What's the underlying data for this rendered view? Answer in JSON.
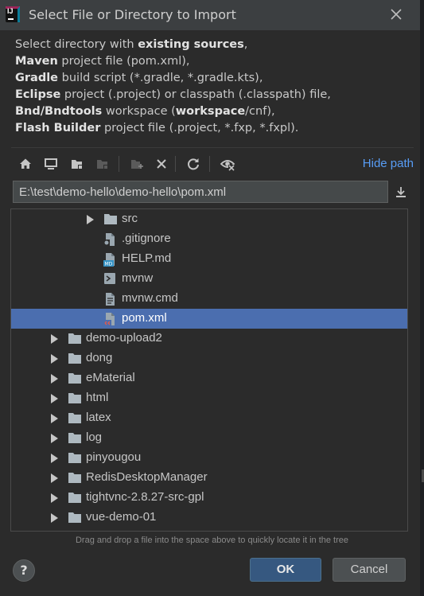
{
  "window": {
    "title": "Select File or Directory to Import",
    "app_icon_text": "IJ"
  },
  "description": [
    [
      {
        "t": "Select directory with ",
        "b": false
      },
      {
        "t": "existing sources",
        "b": true
      },
      {
        "t": ",",
        "b": false
      }
    ],
    [
      {
        "t": "Maven",
        "b": true
      },
      {
        "t": " project file (pom.xml),",
        "b": false
      }
    ],
    [
      {
        "t": "Gradle",
        "b": true
      },
      {
        "t": " build script (*.gradle, *.gradle.kts),",
        "b": false
      }
    ],
    [
      {
        "t": "Eclipse",
        "b": true
      },
      {
        "t": " project (.project) or classpath (.classpath) file,",
        "b": false
      }
    ],
    [
      {
        "t": "Bnd/Bndtools",
        "b": true
      },
      {
        "t": " workspace (",
        "b": false
      },
      {
        "t": "workspace",
        "b": true
      },
      {
        "t": "/cnf),",
        "b": false
      }
    ],
    [
      {
        "t": "Flash Builder",
        "b": true
      },
      {
        "t": " project file (.project, *.fxp, *.fxpl).",
        "b": false
      }
    ]
  ],
  "toolbar": {
    "hide_path_label": "Hide path"
  },
  "path": {
    "value": "E:\\test\\demo-hello\\demo-hello\\pom.xml"
  },
  "tree": [
    {
      "label": "src",
      "icon": "folder-icon",
      "level": 2,
      "arrow": true,
      "selected": false
    },
    {
      "label": ".gitignore",
      "icon": "gitignore-file-icon",
      "level": 2,
      "arrow": false,
      "selected": false
    },
    {
      "label": "HELP.md",
      "icon": "markdown-file-icon",
      "level": 2,
      "arrow": false,
      "selected": false
    },
    {
      "label": "mvnw",
      "icon": "shell-script-icon",
      "level": 2,
      "arrow": false,
      "selected": false
    },
    {
      "label": "mvnw.cmd",
      "icon": "text-file-icon",
      "level": 2,
      "arrow": false,
      "selected": false
    },
    {
      "label": "pom.xml",
      "icon": "maven-pom-icon",
      "level": 2,
      "arrow": false,
      "selected": true
    },
    {
      "label": "demo-upload2",
      "icon": "folder-icon",
      "level": 1,
      "arrow": true,
      "selected": false
    },
    {
      "label": "dong",
      "icon": "folder-icon",
      "level": 1,
      "arrow": true,
      "selected": false
    },
    {
      "label": "eMaterial",
      "icon": "folder-icon",
      "level": 1,
      "arrow": true,
      "selected": false
    },
    {
      "label": "html",
      "icon": "folder-icon",
      "level": 1,
      "arrow": true,
      "selected": false
    },
    {
      "label": "latex",
      "icon": "folder-icon",
      "level": 1,
      "arrow": true,
      "selected": false
    },
    {
      "label": "log",
      "icon": "folder-icon",
      "level": 1,
      "arrow": true,
      "selected": false
    },
    {
      "label": "pinyougou",
      "icon": "folder-icon",
      "level": 1,
      "arrow": true,
      "selected": false
    },
    {
      "label": "RedisDesktopManager",
      "icon": "folder-icon",
      "level": 1,
      "arrow": true,
      "selected": false
    },
    {
      "label": "tightvnc-2.8.27-src-gpl",
      "icon": "folder-icon",
      "level": 1,
      "arrow": true,
      "selected": false
    },
    {
      "label": "vue-demo-01",
      "icon": "folder-icon",
      "level": 1,
      "arrow": true,
      "selected": false
    },
    {
      "label": "",
      "icon": "folder-icon",
      "level": 1,
      "arrow": true,
      "selected": false
    }
  ],
  "hint": "Drag and drop a file into the space above to quickly locate it in the tree",
  "buttons": {
    "help": "?",
    "ok": "OK",
    "cancel": "Cancel"
  },
  "colors": {
    "accent": "#589df6",
    "selection": "#4b6eaf",
    "ok_button": "#365880",
    "folder": "#aeb9c0"
  }
}
